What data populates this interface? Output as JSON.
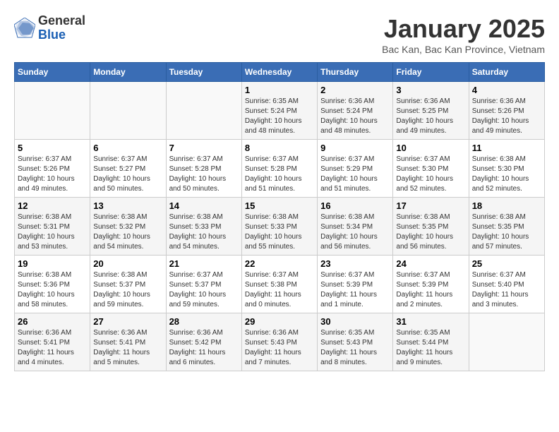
{
  "header": {
    "logo": {
      "general": "General",
      "blue": "Blue"
    },
    "title": "January 2025",
    "location": "Bac Kan, Bac Kan Province, Vietnam"
  },
  "calendar": {
    "weekdays": [
      "Sunday",
      "Monday",
      "Tuesday",
      "Wednesday",
      "Thursday",
      "Friday",
      "Saturday"
    ],
    "weeks": [
      {
        "days": [
          {
            "number": "",
            "sunrise": "",
            "sunset": "",
            "daylight": ""
          },
          {
            "number": "",
            "sunrise": "",
            "sunset": "",
            "daylight": ""
          },
          {
            "number": "",
            "sunrise": "",
            "sunset": "",
            "daylight": ""
          },
          {
            "number": "1",
            "sunrise": "6:35 AM",
            "sunset": "5:24 PM",
            "daylight": "10 hours and 48 minutes."
          },
          {
            "number": "2",
            "sunrise": "6:36 AM",
            "sunset": "5:24 PM",
            "daylight": "10 hours and 48 minutes."
          },
          {
            "number": "3",
            "sunrise": "6:36 AM",
            "sunset": "5:25 PM",
            "daylight": "10 hours and 49 minutes."
          },
          {
            "number": "4",
            "sunrise": "6:36 AM",
            "sunset": "5:26 PM",
            "daylight": "10 hours and 49 minutes."
          }
        ]
      },
      {
        "days": [
          {
            "number": "5",
            "sunrise": "6:37 AM",
            "sunset": "5:26 PM",
            "daylight": "10 hours and 49 minutes."
          },
          {
            "number": "6",
            "sunrise": "6:37 AM",
            "sunset": "5:27 PM",
            "daylight": "10 hours and 50 minutes."
          },
          {
            "number": "7",
            "sunrise": "6:37 AM",
            "sunset": "5:28 PM",
            "daylight": "10 hours and 50 minutes."
          },
          {
            "number": "8",
            "sunrise": "6:37 AM",
            "sunset": "5:28 PM",
            "daylight": "10 hours and 51 minutes."
          },
          {
            "number": "9",
            "sunrise": "6:37 AM",
            "sunset": "5:29 PM",
            "daylight": "10 hours and 51 minutes."
          },
          {
            "number": "10",
            "sunrise": "6:37 AM",
            "sunset": "5:30 PM",
            "daylight": "10 hours and 52 minutes."
          },
          {
            "number": "11",
            "sunrise": "6:38 AM",
            "sunset": "5:30 PM",
            "daylight": "10 hours and 52 minutes."
          }
        ]
      },
      {
        "days": [
          {
            "number": "12",
            "sunrise": "6:38 AM",
            "sunset": "5:31 PM",
            "daylight": "10 hours and 53 minutes."
          },
          {
            "number": "13",
            "sunrise": "6:38 AM",
            "sunset": "5:32 PM",
            "daylight": "10 hours and 54 minutes."
          },
          {
            "number": "14",
            "sunrise": "6:38 AM",
            "sunset": "5:33 PM",
            "daylight": "10 hours and 54 minutes."
          },
          {
            "number": "15",
            "sunrise": "6:38 AM",
            "sunset": "5:33 PM",
            "daylight": "10 hours and 55 minutes."
          },
          {
            "number": "16",
            "sunrise": "6:38 AM",
            "sunset": "5:34 PM",
            "daylight": "10 hours and 56 minutes."
          },
          {
            "number": "17",
            "sunrise": "6:38 AM",
            "sunset": "5:35 PM",
            "daylight": "10 hours and 56 minutes."
          },
          {
            "number": "18",
            "sunrise": "6:38 AM",
            "sunset": "5:35 PM",
            "daylight": "10 hours and 57 minutes."
          }
        ]
      },
      {
        "days": [
          {
            "number": "19",
            "sunrise": "6:38 AM",
            "sunset": "5:36 PM",
            "daylight": "10 hours and 58 minutes."
          },
          {
            "number": "20",
            "sunrise": "6:38 AM",
            "sunset": "5:37 PM",
            "daylight": "10 hours and 59 minutes."
          },
          {
            "number": "21",
            "sunrise": "6:37 AM",
            "sunset": "5:37 PM",
            "daylight": "10 hours and 59 minutes."
          },
          {
            "number": "22",
            "sunrise": "6:37 AM",
            "sunset": "5:38 PM",
            "daylight": "11 hours and 0 minutes."
          },
          {
            "number": "23",
            "sunrise": "6:37 AM",
            "sunset": "5:39 PM",
            "daylight": "11 hours and 1 minute."
          },
          {
            "number": "24",
            "sunrise": "6:37 AM",
            "sunset": "5:39 PM",
            "daylight": "11 hours and 2 minutes."
          },
          {
            "number": "25",
            "sunrise": "6:37 AM",
            "sunset": "5:40 PM",
            "daylight": "11 hours and 3 minutes."
          }
        ]
      },
      {
        "days": [
          {
            "number": "26",
            "sunrise": "6:36 AM",
            "sunset": "5:41 PM",
            "daylight": "11 hours and 4 minutes."
          },
          {
            "number": "27",
            "sunrise": "6:36 AM",
            "sunset": "5:41 PM",
            "daylight": "11 hours and 5 minutes."
          },
          {
            "number": "28",
            "sunrise": "6:36 AM",
            "sunset": "5:42 PM",
            "daylight": "11 hours and 6 minutes."
          },
          {
            "number": "29",
            "sunrise": "6:36 AM",
            "sunset": "5:43 PM",
            "daylight": "11 hours and 7 minutes."
          },
          {
            "number": "30",
            "sunrise": "6:35 AM",
            "sunset": "5:43 PM",
            "daylight": "11 hours and 8 minutes."
          },
          {
            "number": "31",
            "sunrise": "6:35 AM",
            "sunset": "5:44 PM",
            "daylight": "11 hours and 9 minutes."
          },
          {
            "number": "",
            "sunrise": "",
            "sunset": "",
            "daylight": ""
          }
        ]
      }
    ]
  }
}
